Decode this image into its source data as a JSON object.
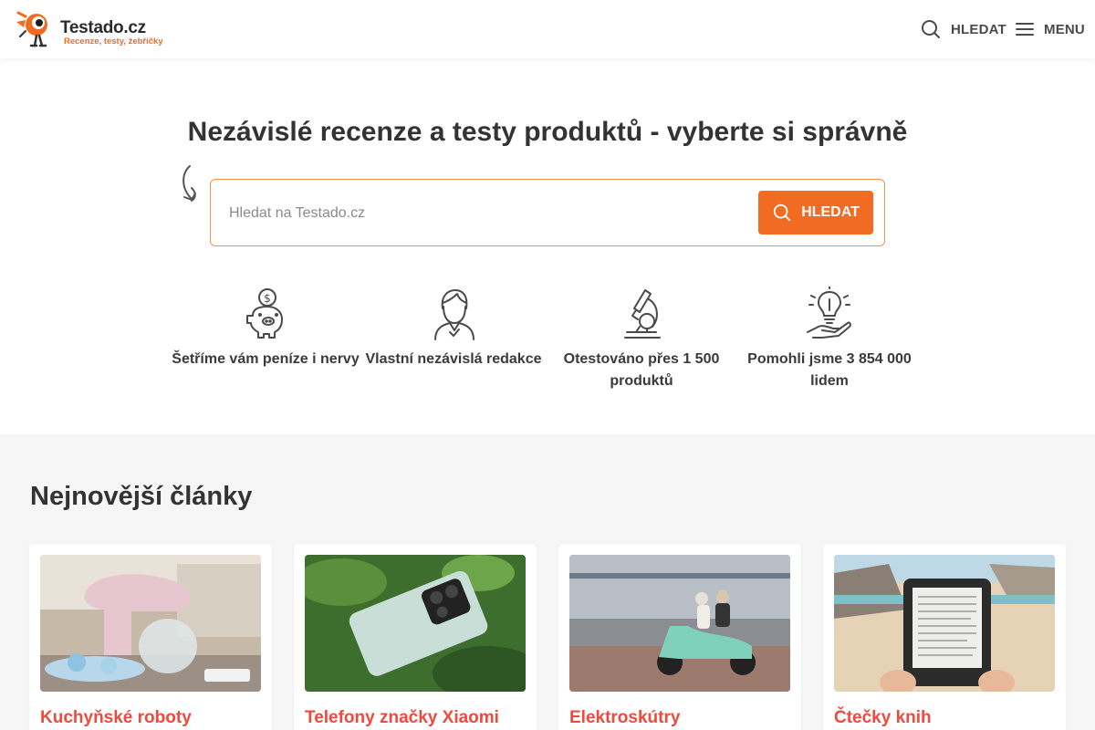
{
  "header": {
    "logo_title": "Testado.cz",
    "logo_subtitle": "Recenze, testy, žebříčky",
    "search_label": "HLEDAT",
    "menu_label": "MENU"
  },
  "hero": {
    "title": "Nezávislé recenze a testy produktů - vyberte si správně",
    "search_placeholder": "Hledat na Testado.cz",
    "search_button": "HLEDAT"
  },
  "features": [
    {
      "icon": "piggy-bank-icon",
      "text": "Šetříme vám peníze i nervy"
    },
    {
      "icon": "person-icon",
      "text": "Vlastní nezávislá redakce"
    },
    {
      "icon": "microscope-icon",
      "text": "Otestováno přes 1 500 produktů"
    },
    {
      "icon": "lightbulb-hand-icon",
      "text": "Pomohli jsme 3 854 000 lidem"
    }
  ],
  "articles": {
    "heading": "Nejnovější články",
    "items": [
      {
        "title": "Kuchyňské roboty"
      },
      {
        "title": "Telefony značky Xiaomi"
      },
      {
        "title": "Elektroskútry"
      },
      {
        "title": "Čtečky knih"
      }
    ]
  },
  "colors": {
    "accent": "#f26b22",
    "card_title": "#ef4a3c"
  }
}
